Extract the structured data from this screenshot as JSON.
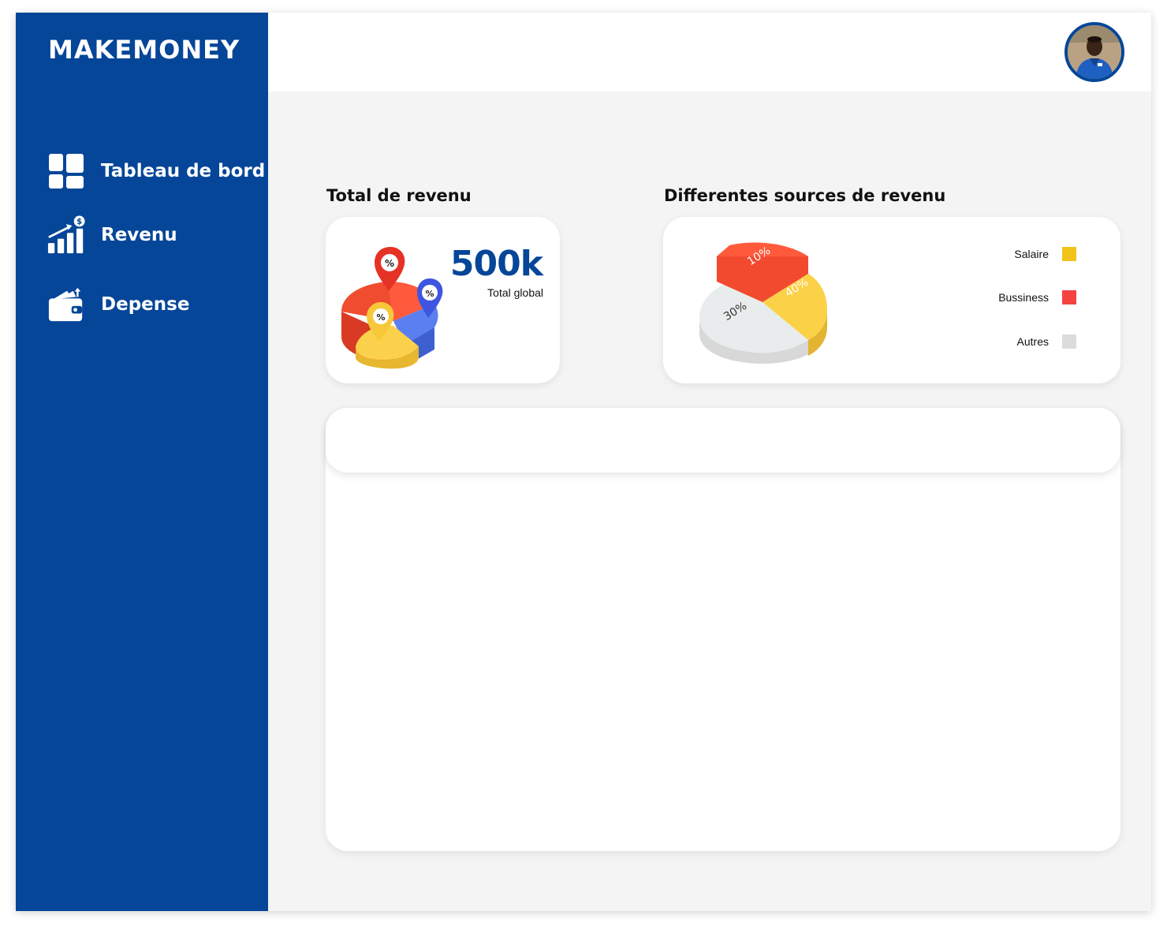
{
  "brand": "MAKEMONEY",
  "nav": [
    {
      "label": "Tableau de bord",
      "icon": "dashboard-icon"
    },
    {
      "label": "Revenu",
      "icon": "revenue-chart-icon"
    },
    {
      "label": "Depense",
      "icon": "wallet-icon"
    }
  ],
  "user": {
    "avatar_icon": "user-avatar"
  },
  "total": {
    "title": "Total de revenu",
    "value": "500k",
    "caption": "Total global"
  },
  "sources": {
    "title": "Differentes sources de revenu",
    "legend": [
      {
        "label": "Salaire",
        "color": "#f2c31b"
      },
      {
        "label": "Bussiness",
        "color": "#f5433f"
      },
      {
        "label": "Autres",
        "color": "#dcdcdc"
      }
    ],
    "pie_labels": [
      "10%",
      "40%",
      "30%"
    ]
  },
  "colors": {
    "sidebar": "#054698",
    "accent": "#054698",
    "background": "#f4f4f4"
  }
}
